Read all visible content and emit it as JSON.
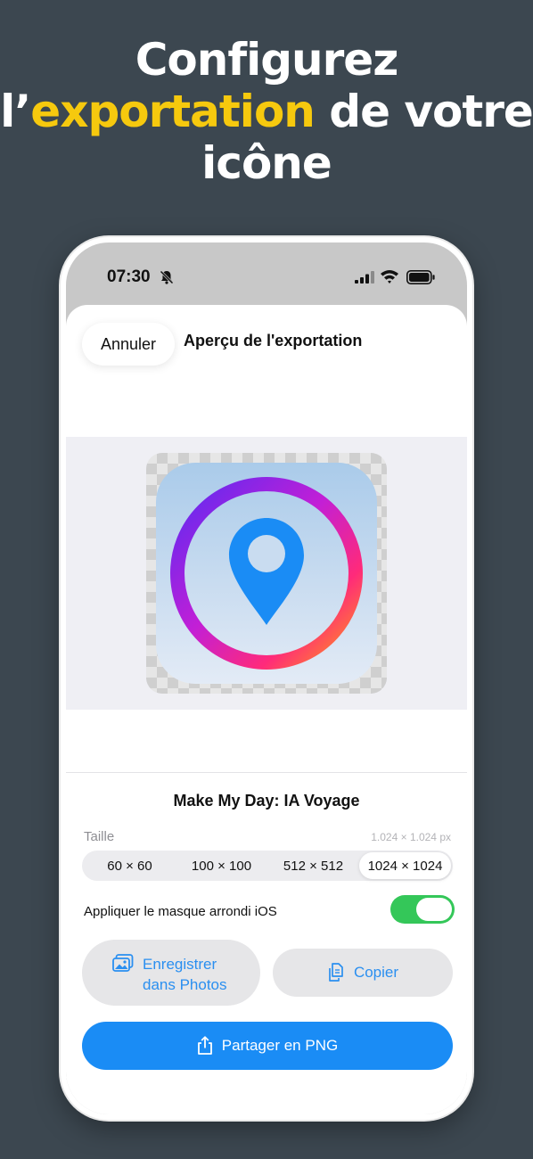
{
  "headline": {
    "line1": "Configurez",
    "prefix": "l’",
    "highlight": "exportation",
    "suffix": " de votre",
    "line3": "icône"
  },
  "status_bar": {
    "time": "07:30",
    "icons": [
      "bell-slash-icon",
      "cellular-signal-icon",
      "wifi-icon",
      "battery-icon"
    ]
  },
  "nav": {
    "cancel_label": "Annuler",
    "title": "Aperçu de l'exportation"
  },
  "preview": {
    "icon_name": "location-pin-ring-icon"
  },
  "project_name": "Make My Day: IA Voyage",
  "size": {
    "label": "Taille",
    "readout": "1.024 × 1.024 px",
    "options": [
      "60 × 60",
      "100 × 100",
      "512 × 512",
      "1024 × 1024"
    ],
    "selected": "1024 × 1024"
  },
  "mask_toggle": {
    "label": "Appliquer le masque arrondi iOS",
    "on": true
  },
  "actions": {
    "save_label_line1": "Enregistrer",
    "save_label_line2": "dans Photos",
    "copy_label": "Copier",
    "share_label": "Partager en PNG"
  },
  "colors": {
    "background": "#3c4750",
    "highlight": "#f6c90e",
    "accent": "#1a8cf5",
    "toggle_on": "#34c759"
  }
}
